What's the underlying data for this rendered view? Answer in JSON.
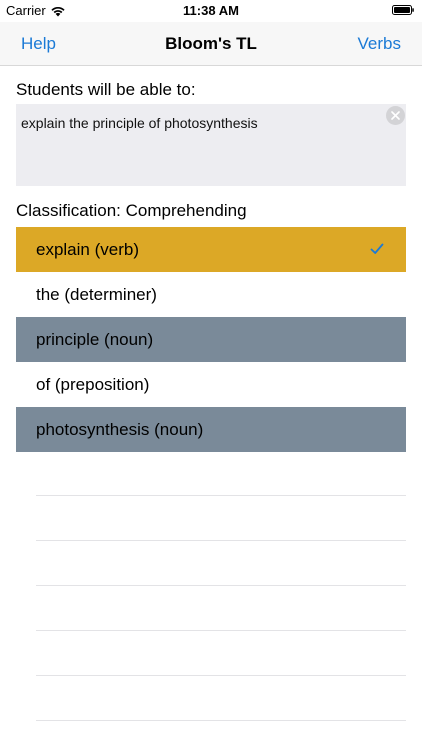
{
  "status_bar": {
    "carrier": "Carrier",
    "time": "11:38 AM",
    "icons": [
      "wifi-icon",
      "battery-icon"
    ]
  },
  "nav": {
    "left_label": "Help",
    "title": "Bloom's TL",
    "right_label": "Verbs",
    "accent_color": "#1b7ad6"
  },
  "prompt_label": "Students will be able to:",
  "objective_text": "explain the principle of photosynthesis",
  "classification_label": "Classification: Comprehending",
  "words": [
    {
      "label": "explain (verb)",
      "type": "verb",
      "selected": true
    },
    {
      "label": "the (determiner)",
      "type": "plain",
      "selected": false
    },
    {
      "label": "principle (noun)",
      "type": "noun",
      "selected": false
    },
    {
      "label": "of (preposition)",
      "type": "plain",
      "selected": false
    },
    {
      "label": "photosynthesis (noun)",
      "type": "noun",
      "selected": false
    }
  ],
  "colors": {
    "verb_highlight": "#dca826",
    "noun_highlight": "#7a8a99",
    "text_box_background": "#ededf1"
  }
}
